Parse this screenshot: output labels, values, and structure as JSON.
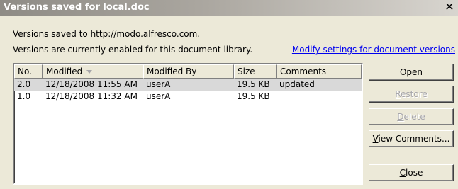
{
  "window": {
    "title": "Versions saved for local.doc",
    "close_glyph": "✕"
  },
  "info": {
    "line1": "Versions saved to http://modo.alfresco.com.",
    "line2": "Versions are currently enabled for this document library.",
    "modify_link": "Modify settings for document versions"
  },
  "table": {
    "columns": [
      "No.",
      "Modified",
      "Modified By",
      "Size",
      "Comments"
    ],
    "sorted_column": "Modified",
    "rows": [
      {
        "no": "2.0",
        "modified": "12/18/2008 11:55 AM",
        "by": "userA",
        "size": "19.5 KB",
        "comments": "updated",
        "selected": true
      },
      {
        "no": "1.0",
        "modified": "12/18/2008 11:32 AM",
        "by": "userA",
        "size": "19.5 KB",
        "comments": "",
        "selected": false
      }
    ]
  },
  "buttons": {
    "open": {
      "first": "O",
      "rest": "pen",
      "enabled": true
    },
    "restore": {
      "first": "R",
      "rest": "estore",
      "enabled": false
    },
    "delete": {
      "first": "D",
      "rest": "elete",
      "enabled": false
    },
    "view_comments": {
      "first": "V",
      "rest": "iew Comments...",
      "enabled": true
    },
    "close": {
      "first": "C",
      "rest": "lose",
      "enabled": true
    }
  },
  "colors": {
    "link": "#0000ee",
    "selected_row": "#d9d9d9",
    "disabled_text": "#a7a6aa"
  }
}
